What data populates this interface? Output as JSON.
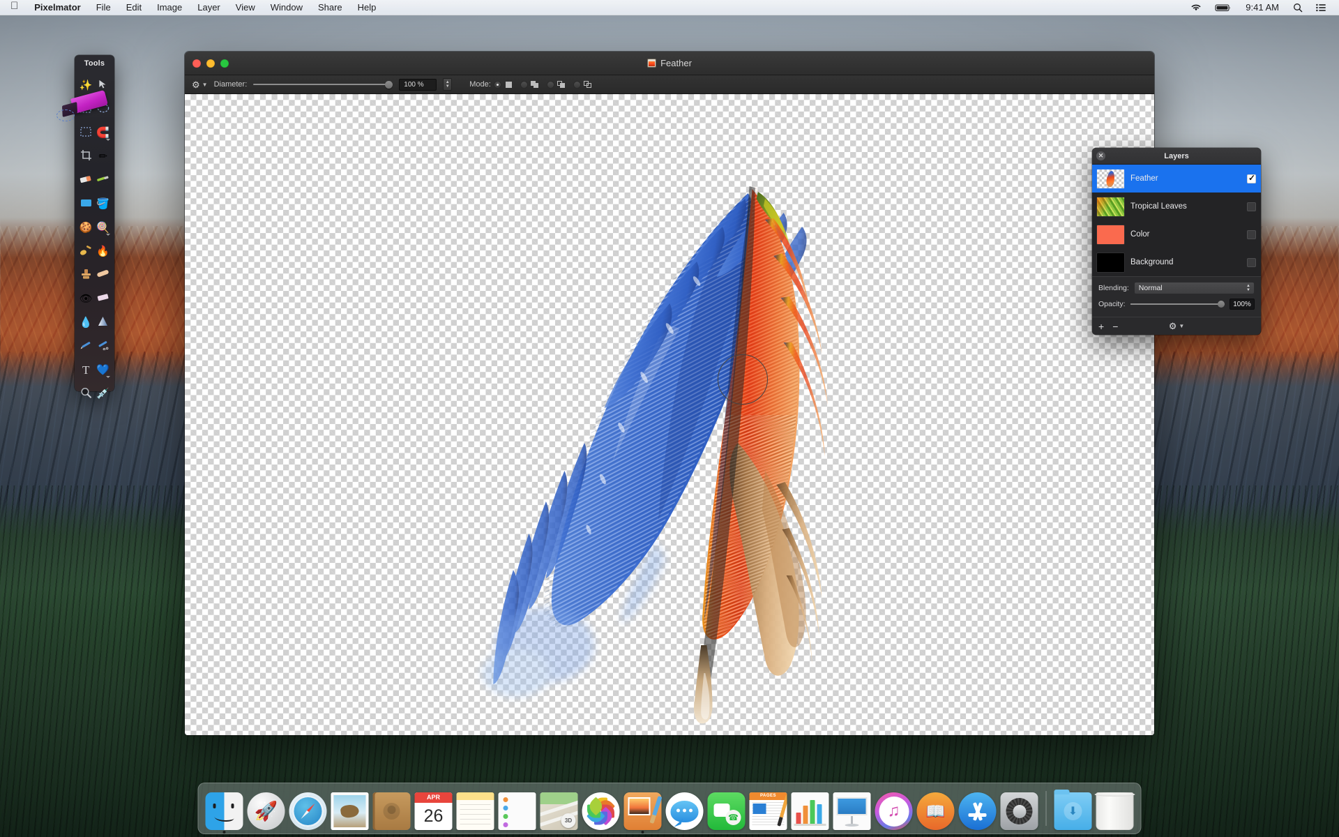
{
  "menubar": {
    "apple_icon": "apple-logo",
    "app_name": "Pixelmator",
    "items": [
      "File",
      "Edit",
      "Image",
      "Layer",
      "View",
      "Window",
      "Share",
      "Help"
    ],
    "extras": {
      "wifi_icon": "wifi-icon",
      "battery_icon": "battery-icon",
      "time": "9:41 AM",
      "search_icon": "search-icon",
      "notifications_icon": "list-icon"
    }
  },
  "window": {
    "title": "Feather",
    "proxy_icon": "document-icon",
    "toolbar": {
      "gear_label": "brush-settings-gear",
      "diameter_label": "Diameter:",
      "diameter_value": "100 %",
      "diameter_percent": 100,
      "mode_label": "Mode:",
      "modes": [
        {
          "name": "new-selection",
          "selected": true
        },
        {
          "name": "add-to-selection",
          "selected": false
        },
        {
          "name": "subtract-from-selection",
          "selected": false
        },
        {
          "name": "intersect-selection",
          "selected": false
        }
      ]
    }
  },
  "tools": {
    "title": "Tools",
    "items": [
      {
        "name": "magic-wand-tool",
        "glyph": "✨",
        "has_submenu": false
      },
      {
        "name": "move-tool",
        "glyph": "➤",
        "has_submenu": false
      },
      {
        "name": "rectangular-marquee-tool",
        "glyph": "⬚",
        "has_submenu": false
      },
      {
        "name": "elliptical-marquee-tool",
        "glyph": "◌",
        "has_submenu": false
      },
      {
        "name": "quick-selection-tool",
        "glyph": "⬚",
        "has_submenu": false
      },
      {
        "name": "magnetic-selection-tool",
        "glyph": "🧲",
        "has_submenu": true
      },
      {
        "name": "crop-tool",
        "glyph": "⧉",
        "has_submenu": false
      },
      {
        "name": "paint-tool",
        "glyph": "✏",
        "has_submenu": false
      },
      {
        "name": "eraser-tool",
        "glyph": "🧹",
        "has_submenu": false
      },
      {
        "name": "paintbrush-tool",
        "glyph": "🖌",
        "has_submenu": false
      },
      {
        "name": "color-fill-tool",
        "glyph": "▭",
        "has_submenu": false
      },
      {
        "name": "paint-bucket-tool",
        "glyph": "🪣",
        "has_submenu": false
      },
      {
        "name": "dodge-tool",
        "glyph": "🍪",
        "has_submenu": false
      },
      {
        "name": "sponge-tool",
        "glyph": "🍭",
        "has_submenu": true
      },
      {
        "name": "smudge-tool",
        "glyph": "🧹",
        "has_submenu": false
      },
      {
        "name": "burn-tool",
        "glyph": "🔥",
        "has_submenu": false
      },
      {
        "name": "clone-stamp-tool",
        "glyph": "🔨",
        "has_submenu": false
      },
      {
        "name": "repair-tool",
        "glyph": "🩹",
        "has_submenu": false
      },
      {
        "name": "red-eye-tool",
        "glyph": "👁",
        "has_submenu": false
      },
      {
        "name": "eraser-alt-tool",
        "glyph": "▱",
        "has_submenu": false
      },
      {
        "name": "blur-tool",
        "glyph": "💧",
        "has_submenu": false
      },
      {
        "name": "sharpen-tool",
        "glyph": "▲",
        "has_submenu": false
      },
      {
        "name": "pencil-tool",
        "glyph": "✏",
        "has_submenu": false
      },
      {
        "name": "pen-tool",
        "glyph": "🖊",
        "has_submenu": false
      },
      {
        "name": "type-tool",
        "glyph": "T",
        "has_submenu": false
      },
      {
        "name": "shape-tool",
        "glyph": "💙",
        "has_submenu": true
      },
      {
        "name": "zoom-tool",
        "glyph": "🔍",
        "has_submenu": false
      },
      {
        "name": "color-picker-tool",
        "glyph": "💉",
        "has_submenu": false
      }
    ],
    "cursor": "marker-brush-cursor"
  },
  "layers_panel": {
    "title": "Layers",
    "close_icon": "close-icon",
    "layers": [
      {
        "name": "Feather",
        "selected": true,
        "visible": true,
        "thumb": "feather-thumb"
      },
      {
        "name": "Tropical Leaves",
        "selected": false,
        "visible": false,
        "thumb": "leaves-thumb"
      },
      {
        "name": "Color",
        "selected": false,
        "visible": false,
        "thumb": "color-thumb",
        "color": "#fa6a4e"
      },
      {
        "name": "Background",
        "selected": false,
        "visible": false,
        "thumb": "background-thumb",
        "color": "#000000"
      }
    ],
    "blending_label": "Blending:",
    "blending_value": "Normal",
    "opacity_label": "Opacity:",
    "opacity_value": "100%",
    "opacity_percent": 100,
    "add_label": "+",
    "remove_label": "−",
    "gear_label": "layer-actions-gear",
    "selection_color": "#1a72ee"
  },
  "canvas": {
    "artwork": "feather-image",
    "brush_cursor": "circle-brush-cursor"
  },
  "dock": {
    "items": [
      {
        "name": "finder",
        "label": "Finder",
        "running": true
      },
      {
        "name": "launchpad",
        "label": "Launchpad",
        "running": false
      },
      {
        "name": "safari",
        "label": "Safari",
        "running": false
      },
      {
        "name": "mail",
        "label": "Mail",
        "running": false
      },
      {
        "name": "contacts",
        "label": "Contacts",
        "running": false
      },
      {
        "name": "calendar",
        "label": "Calendar",
        "running": false,
        "month": "APR",
        "day": "26"
      },
      {
        "name": "notes",
        "label": "Notes",
        "running": false
      },
      {
        "name": "reminders",
        "label": "Reminders",
        "running": false
      },
      {
        "name": "maps",
        "label": "Maps",
        "running": false,
        "badge": "3D"
      },
      {
        "name": "photos",
        "label": "Photos",
        "running": false
      },
      {
        "name": "pixelmator",
        "label": "Pixelmator",
        "running": true
      },
      {
        "name": "messages",
        "label": "Messages",
        "running": false
      },
      {
        "name": "facetime",
        "label": "FaceTime",
        "running": false
      },
      {
        "name": "pages",
        "label": "Pages",
        "running": false,
        "text": "PAGES"
      },
      {
        "name": "numbers",
        "label": "Numbers",
        "running": false
      },
      {
        "name": "keynote",
        "label": "Keynote",
        "running": false
      },
      {
        "name": "itunes",
        "label": "iTunes",
        "running": false
      },
      {
        "name": "ibooks",
        "label": "iBooks",
        "running": false
      },
      {
        "name": "app-store",
        "label": "App Store",
        "running": false
      },
      {
        "name": "system-preferences",
        "label": "System Preferences",
        "running": false
      },
      {
        "name": "downloads",
        "label": "Downloads",
        "running": false
      },
      {
        "name": "trash",
        "label": "Trash",
        "running": false
      }
    ]
  }
}
